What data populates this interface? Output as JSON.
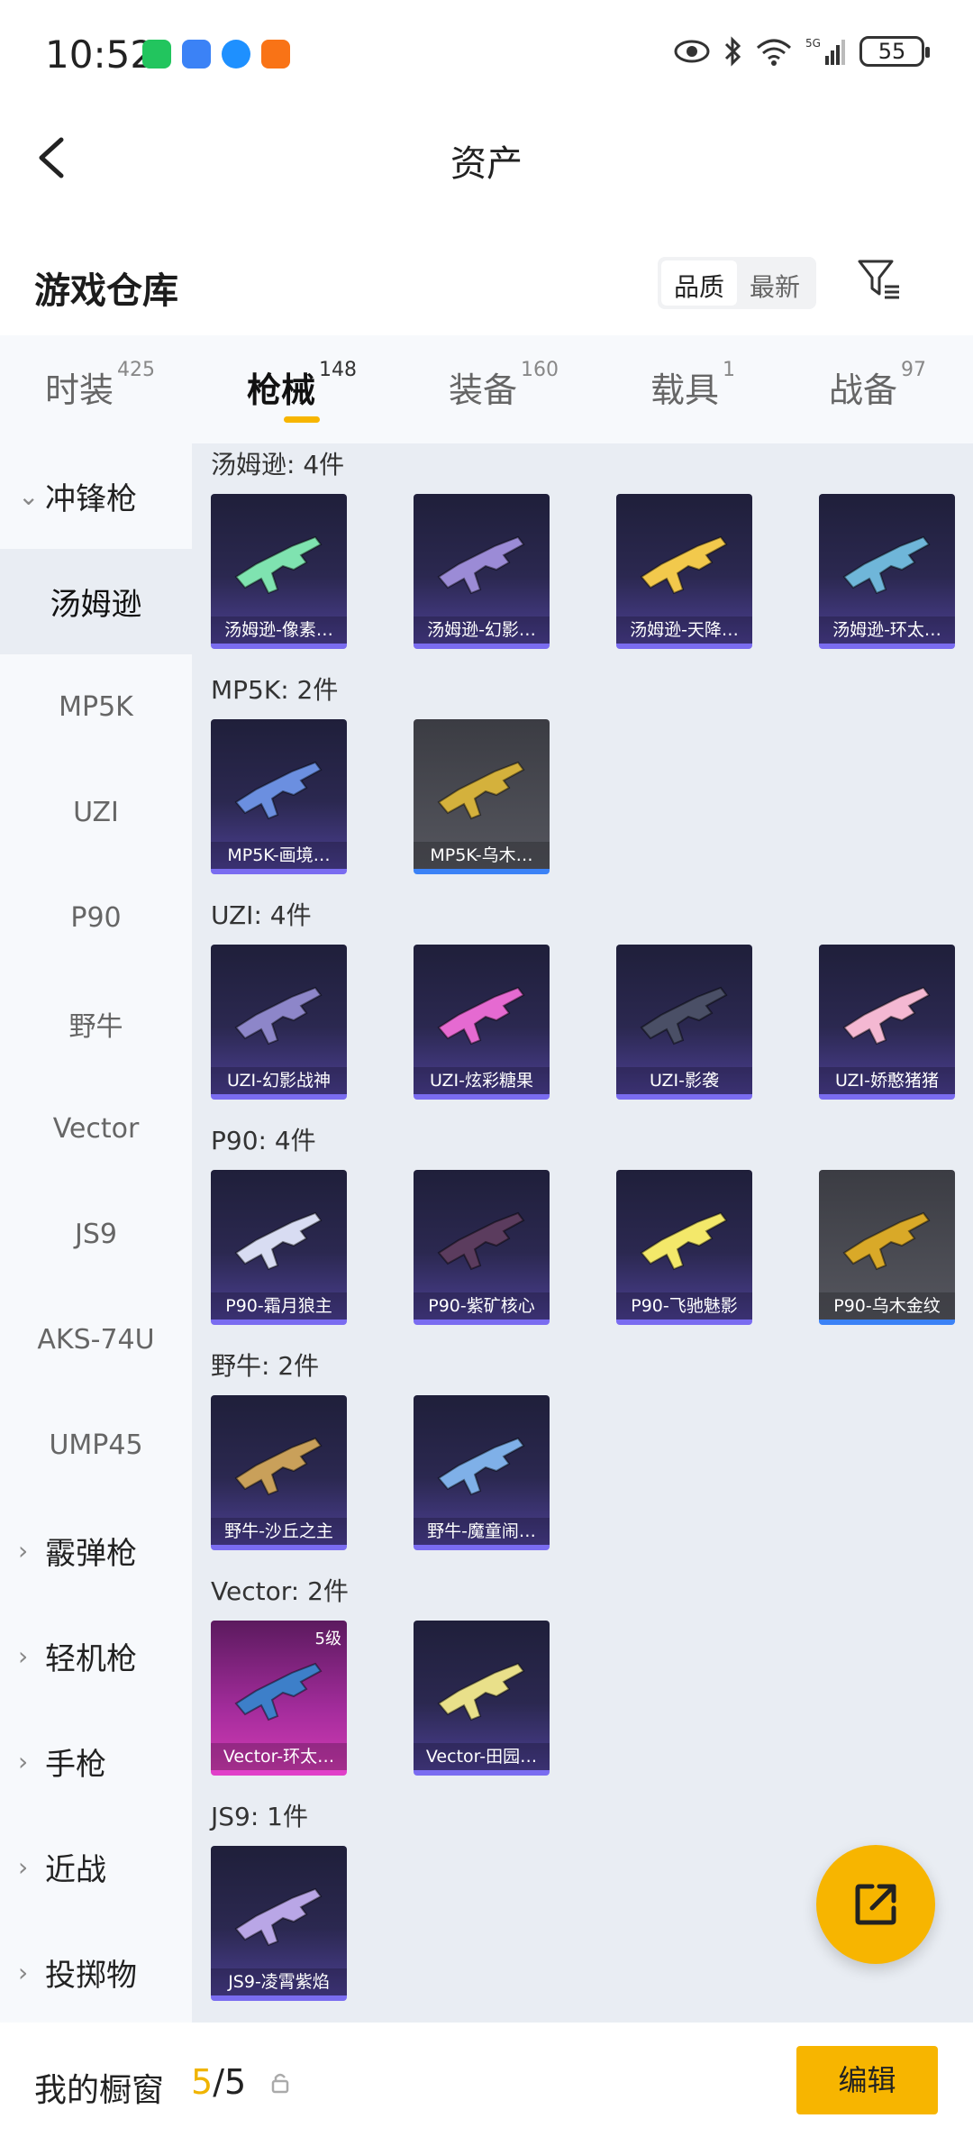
{
  "status_bar": {
    "time": "10:52",
    "battery": "55",
    "app_icons": [
      {
        "name": "wechat-icon",
        "color": "#22c55e"
      },
      {
        "name": "message-icon",
        "color": "#3b82f6"
      },
      {
        "name": "browser-icon",
        "color": "#1e90ff"
      },
      {
        "name": "app-icon",
        "color": "#f97316"
      }
    ]
  },
  "header": {
    "title": "资产"
  },
  "warehouse": {
    "title": "游戏仓库",
    "sort_options": [
      "品质",
      "最新"
    ],
    "active_sort": "品质"
  },
  "tabs": [
    {
      "label": "时装",
      "count": "425"
    },
    {
      "label": "枪械",
      "count": "148",
      "active": true
    },
    {
      "label": "装备",
      "count": "160"
    },
    {
      "label": "载具",
      "count": "1"
    },
    {
      "label": "战备",
      "count": "97"
    }
  ],
  "sidebar": {
    "items": [
      {
        "label": "冲锋枪",
        "group": true,
        "expanded": true
      },
      {
        "label": "汤姆逊",
        "selected": true
      },
      {
        "label": "MP5K"
      },
      {
        "label": "UZI"
      },
      {
        "label": "P90"
      },
      {
        "label": "野牛"
      },
      {
        "label": "Vector"
      },
      {
        "label": "JS9"
      },
      {
        "label": "AKS-74U"
      },
      {
        "label": "UMP45"
      },
      {
        "label": "霰弹枪",
        "group": true
      },
      {
        "label": "轻机枪",
        "group": true
      },
      {
        "label": "手枪",
        "group": true
      },
      {
        "label": "近战",
        "group": true
      },
      {
        "label": "投掷物",
        "group": true
      }
    ]
  },
  "sections": [
    {
      "title": "汤姆逊: 4件",
      "items": [
        {
          "label": "汤姆逊-像素…",
          "style": "purple",
          "gun_color": "#7fe3b0"
        },
        {
          "label": "汤姆逊-幻影…",
          "style": "purple",
          "gun_color": "#9b8bd6"
        },
        {
          "label": "汤姆逊-天降…",
          "style": "purple",
          "gun_color": "#f2c94c"
        },
        {
          "label": "汤姆逊-环太…",
          "style": "purple",
          "gun_color": "#6fb6d9"
        }
      ]
    },
    {
      "title": "MP5K: 2件",
      "items": [
        {
          "label": "MP5K-画境…",
          "style": "purple",
          "gun_color": "#6b8fe0"
        },
        {
          "label": "MP5K-乌木…",
          "style": "gray",
          "gun_color": "#d4b13c"
        }
      ]
    },
    {
      "title": "UZI: 4件",
      "items": [
        {
          "label": "UZI-幻影战神",
          "style": "purple",
          "gun_color": "#8d86c9"
        },
        {
          "label": "UZI-炫彩糖果",
          "style": "purple",
          "gun_color": "#e56ad1"
        },
        {
          "label": "UZI-影袭",
          "style": "purple",
          "gun_color": "#4a4f66"
        },
        {
          "label": "UZI-娇憨猪猪",
          "style": "purple",
          "gun_color": "#f4b8d2"
        }
      ]
    },
    {
      "title": "P90: 4件",
      "items": [
        {
          "label": "P90-霜月狼主",
          "style": "purple",
          "gun_color": "#d8dcf2"
        },
        {
          "label": "P90-紫矿核心",
          "style": "purple",
          "gun_color": "#5b3c5e"
        },
        {
          "label": "P90-飞驰魅影",
          "style": "purple",
          "gun_color": "#f3e86a"
        },
        {
          "label": "P90-乌木金纹",
          "style": "gray",
          "gun_color": "#d9a928"
        }
      ]
    },
    {
      "title": "野牛: 2件",
      "items": [
        {
          "label": "野牛-沙丘之主",
          "style": "purple",
          "gun_color": "#c9a05a"
        },
        {
          "label": "野牛-魔童闹…",
          "style": "purple",
          "gun_color": "#7fb0e8"
        }
      ]
    },
    {
      "title": "Vector: 2件",
      "items": [
        {
          "label": "Vector-环太…",
          "style": "pink",
          "gun_color": "#3d7fc9",
          "level": "5级"
        },
        {
          "label": "Vector-田园…",
          "style": "purple",
          "gun_color": "#e9e08a"
        }
      ]
    },
    {
      "title": "JS9: 1件",
      "items": [
        {
          "label": "JS9-凌霄紫焰",
          "style": "purple",
          "gun_color": "#b9a6e6"
        }
      ]
    }
  ],
  "bottom_bar": {
    "label": "我的橱窗",
    "current": "5",
    "separator": "/",
    "total": "5",
    "edit_label": "编辑"
  },
  "fab": {
    "icon": "share-icon"
  }
}
